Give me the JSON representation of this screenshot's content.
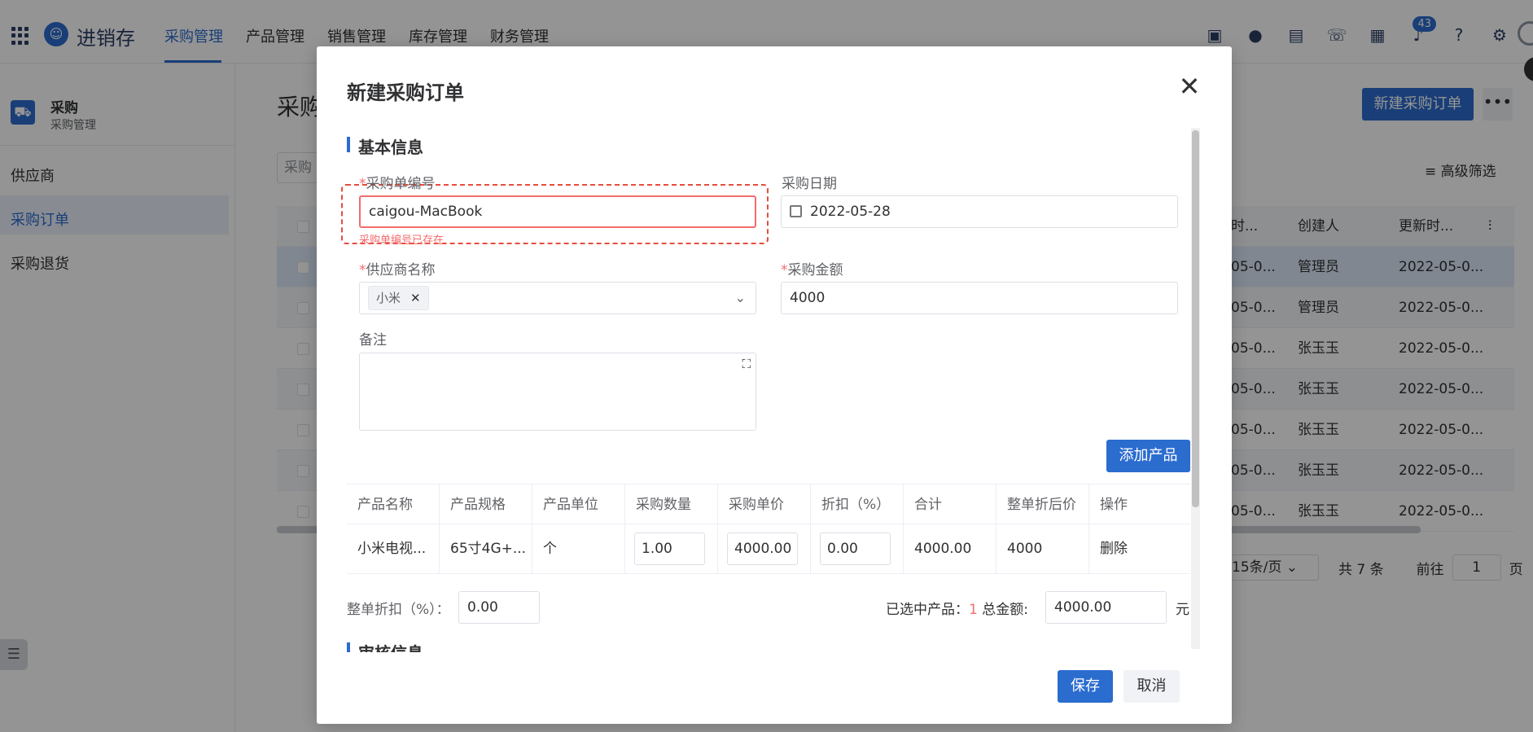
{
  "app": {
    "name": "进销存",
    "nav": [
      "采购管理",
      "产品管理",
      "销售管理",
      "库存管理",
      "财务管理"
    ],
    "notification_count": "43"
  },
  "sidebar": {
    "title": "采购",
    "subtitle": "采购管理",
    "items": [
      "供应商",
      "采购订单",
      "采购退货"
    ]
  },
  "page": {
    "title": "采购",
    "search_placeholder": "采购",
    "new_button": "新建采购订单",
    "more_button": "•••",
    "filter_label": "高级筛选",
    "table": {
      "headers": [
        "时...",
        "创建人",
        "更新时..."
      ],
      "rows": [
        [
          "05-0...",
          "管理员",
          "2022-05-0..."
        ],
        [
          "05-0...",
          "管理员",
          "2022-05-0..."
        ],
        [
          "05-0...",
          "张玉玉",
          "2022-05-0..."
        ],
        [
          "05-0...",
          "张玉玉",
          "2022-05-0..."
        ],
        [
          "05-0...",
          "张玉玉",
          "2022-05-0..."
        ],
        [
          "05-0...",
          "张玉玉",
          "2022-05-0..."
        ],
        [
          "05-0...",
          "张玉玉",
          "2022-05-0..."
        ]
      ]
    },
    "pagination": {
      "page_size": "15条/页",
      "total": "共 7 条",
      "goto_label": "前往",
      "goto_value": "1",
      "page_suffix": "页"
    }
  },
  "dialog": {
    "title": "新建采购订单",
    "section_basic": "基本信息",
    "order_no_label": "采购单编号",
    "order_no_value": "caigou-MacBook",
    "order_no_error": "采购单编号已存在",
    "date_label": "采购日期",
    "date_value": "2022-05-28",
    "supplier_label": "供应商名称",
    "supplier_tag": "小米",
    "amount_label": "采购金额",
    "amount_value": "4000",
    "remark_label": "备注",
    "add_product_button": "添加产品",
    "product_table": {
      "headers": [
        "产品名称",
        "产品规格",
        "产品单位",
        "采购数量",
        "采购单价",
        "折扣（%）",
        "合计",
        "整单折后价",
        "操作"
      ],
      "row": {
        "name": "小米电视...",
        "spec": "65寸4G+...",
        "unit": "个",
        "quantity": "1.00",
        "unit_price": "4000.00",
        "discount": "0.00",
        "subtotal": "4000.00",
        "final_price": "4000",
        "action": "删除"
      }
    },
    "order_discount_label": "整单折扣（%）：",
    "order_discount_value": "0.00",
    "selected_label": "已选中产品：",
    "selected_count": "1",
    "total_label": "总金额:",
    "total_value": "4000.00",
    "currency": "元",
    "section_audit": "审核信息",
    "save_button": "保存",
    "cancel_button": "取消"
  }
}
